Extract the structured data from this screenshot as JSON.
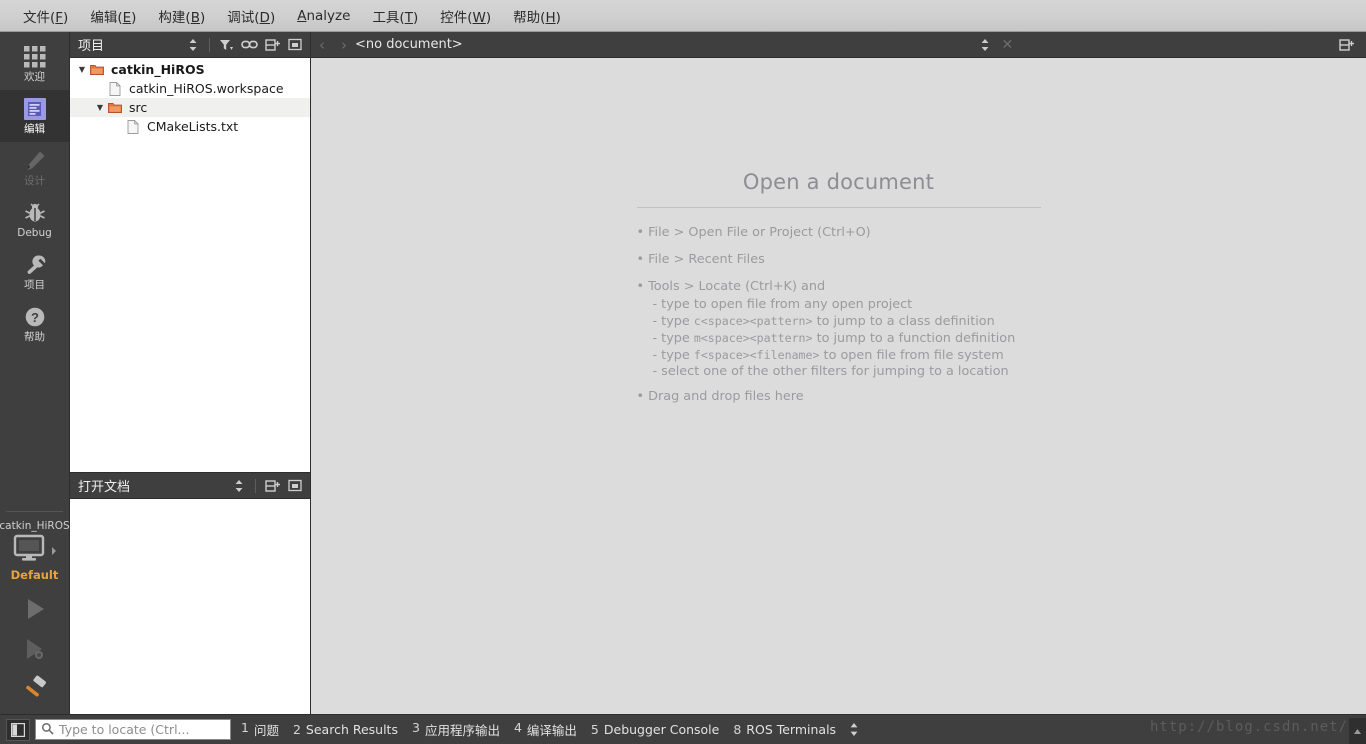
{
  "menubar": {
    "items": [
      {
        "pre": "文件(",
        "key": "F",
        "post": ")"
      },
      {
        "pre": "编辑(",
        "key": "E",
        "post": ")"
      },
      {
        "pre": "构建(",
        "key": "B",
        "post": ")"
      },
      {
        "pre": "调试(",
        "key": "D",
        "post": ")"
      },
      {
        "pre": "",
        "key": "A",
        "post": "nalyze"
      },
      {
        "pre": "工具(",
        "key": "T",
        "post": ")"
      },
      {
        "pre": "控件(",
        "key": "W",
        "post": ")"
      },
      {
        "pre": "帮助(",
        "key": "H",
        "post": ")"
      }
    ]
  },
  "modebar": {
    "modes": [
      {
        "label": "欢迎",
        "icon": "grid-icon",
        "state": "normal"
      },
      {
        "label": "编辑",
        "icon": "edit-document-icon",
        "state": "active"
      },
      {
        "label": "设计",
        "icon": "pencil-icon",
        "state": "disabled"
      },
      {
        "label": "Debug",
        "icon": "bug-icon",
        "state": "normal"
      },
      {
        "label": "项目",
        "icon": "wrench-icon",
        "state": "normal"
      },
      {
        "label": "帮助",
        "icon": "question-circle-icon",
        "state": "normal"
      }
    ],
    "kit": {
      "project_name": "catkin_HiROS",
      "config_name": "Default",
      "icon": "desktop-monitor-icon",
      "expand_icon": "chevron-right-icon"
    },
    "actions": [
      {
        "name": "run-button",
        "icon": "play-triangle-icon",
        "state": "disabled"
      },
      {
        "name": "debug-button",
        "icon": "play-bug-icon",
        "state": "disabled"
      },
      {
        "name": "build-button",
        "icon": "hammer-icon",
        "state": "enabled"
      }
    ]
  },
  "project_pane": {
    "title": "项目",
    "tools": [
      {
        "name": "sync-selection-button",
        "icon": "up-down-arrows-icon"
      },
      {
        "name": "filter-button",
        "icon": "filter-icon"
      },
      {
        "name": "link-with-editor-button",
        "icon": "chain-link-icon"
      },
      {
        "name": "split-button",
        "icon": "split-pane-icon"
      },
      {
        "name": "close-pane-button",
        "icon": "minimize-icon"
      }
    ],
    "tree": [
      {
        "label": "catkin_HiROS",
        "icon": "folder-icon",
        "indent": 0,
        "arrow": "▼",
        "bold": true,
        "alt": false
      },
      {
        "label": "catkin_HiROS.workspace",
        "icon": "file-icon",
        "indent": 1,
        "arrow": "",
        "bold": false,
        "alt": false
      },
      {
        "label": "src",
        "icon": "folder-icon",
        "indent": 1,
        "arrow": "▼",
        "bold": false,
        "alt": true
      },
      {
        "label": "CMakeLists.txt",
        "icon": "file-icon",
        "indent": 2,
        "arrow": "",
        "bold": false,
        "alt": false
      }
    ]
  },
  "opendocs_pane": {
    "title": "打开文档",
    "tools": [
      {
        "name": "sync-selection-button",
        "icon": "up-down-arrows-icon"
      },
      {
        "name": "split-button",
        "icon": "split-pane-icon"
      },
      {
        "name": "close-pane-button",
        "icon": "minimize-icon"
      }
    ],
    "items": []
  },
  "editor": {
    "back_icon": "chevron-left-icon",
    "forward_icon": "chevron-right-icon",
    "document_label": "<no document>",
    "combo_icon": "up-down-arrows-icon",
    "close_icon": "close-x-icon",
    "split_icon": "split-pane-icon",
    "welcome": {
      "title": "Open a document",
      "lines": [
        {
          "type": "bullet",
          "text": "• File > Open File or Project (Ctrl+O)"
        },
        {
          "type": "bullet",
          "text": "• File > Recent Files"
        },
        {
          "type": "bullet",
          "text": "• Tools > Locate (Ctrl+K) and"
        },
        {
          "type": "sub",
          "text": "- type to open file from any open project"
        },
        {
          "type": "sub-mono",
          "pre": "- type ",
          "mono": "c<space><pattern>",
          "post": " to jump to a class definition"
        },
        {
          "type": "sub-mono",
          "pre": "- type ",
          "mono": "m<space><pattern>",
          "post": " to jump to a function definition"
        },
        {
          "type": "sub-mono",
          "pre": "- type ",
          "mono": "f<space><filename>",
          "post": " to open file from file system"
        },
        {
          "type": "sub",
          "text": "- select one of the other filters for jumping to a location"
        },
        {
          "type": "bullet",
          "text": "• Drag and drop files here"
        }
      ]
    }
  },
  "statusbar": {
    "toggle_icon": "toggle-sidebar-icon",
    "search_icon": "magnifier-icon",
    "locate_placeholder": "Type to locate (Ctrl...",
    "locate_value": "",
    "items": [
      {
        "num": "1",
        "label": "问题"
      },
      {
        "num": "2",
        "label": "Search Results"
      },
      {
        "num": "3",
        "label": "应用程序输出"
      },
      {
        "num": "4",
        "label": "编译输出"
      },
      {
        "num": "5",
        "label": "Debugger Console"
      },
      {
        "num": "8",
        "label": "ROS Terminals"
      }
    ],
    "arrows_icon": "up-down-arrows-icon",
    "watermark": "http://blog.csdn.net/",
    "grip_icon": "resize-grip-icon"
  },
  "colors": {
    "dark_chrome": "#3f3f3f",
    "menu_bg": "#cfcfcf",
    "editor_bg": "#dcdcdc",
    "accent_orange": "#e8a33d",
    "active_mode_icon": "#9a9ae0"
  }
}
